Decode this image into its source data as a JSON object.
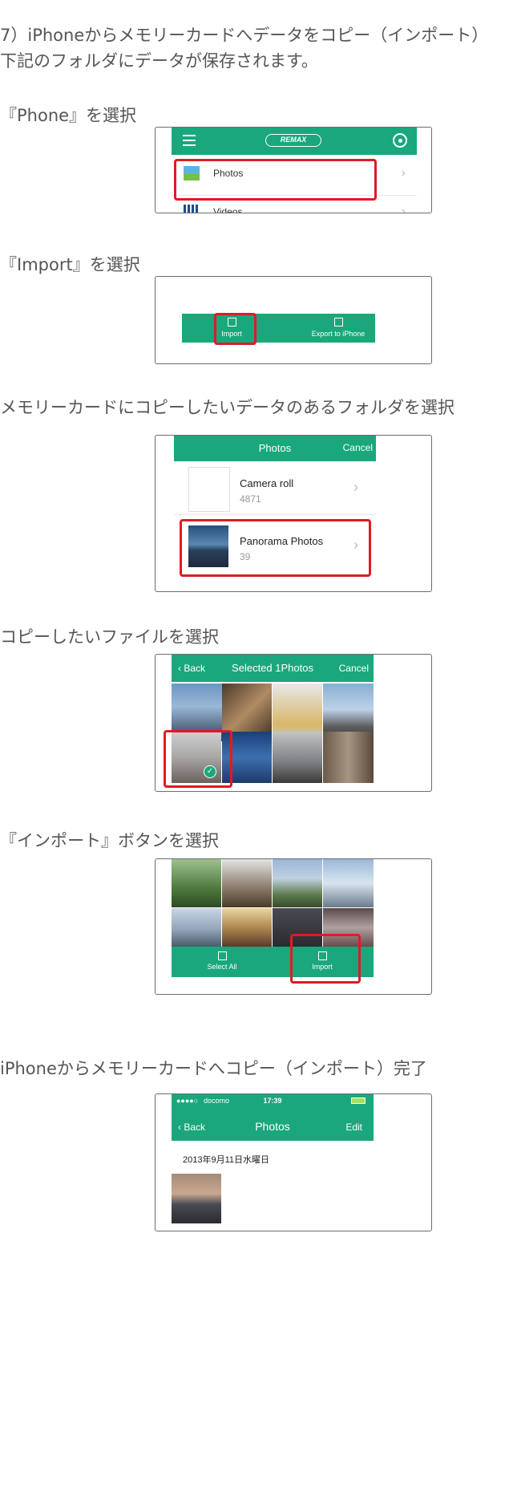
{
  "steps": {
    "title": "7）iPhoneからメモリーカードへデータをコピー（インポート）",
    "subtitle": "下記のフォルダにデータが保存されます。",
    "s1": "『Phone』を選択",
    "s2": "『Import』を選択",
    "s3": "メモリーカードにコピーしたいデータのあるフォルダを選択",
    "s4": "コピーしたいファイルを選択",
    "s5": "『インポート』ボタンを選択",
    "s6": "iPhoneからメモリーカードへコピー（インポート）完了"
  },
  "shot1": {
    "logo": "REMAX",
    "item1": "Photos",
    "item2": "Videos"
  },
  "shot2": {
    "import": "Import",
    "export": "Export to iPhone"
  },
  "shot3": {
    "header": "Photos",
    "cancel": "Cancel",
    "album1_name": "Camera roll",
    "album1_count": "4871",
    "album2_name": "Panorama Photos",
    "album2_count": "39"
  },
  "shot4": {
    "back": "Back",
    "title": "Selected 1Photos",
    "cancel": "Cancel"
  },
  "shot5": {
    "select_all": "Select All",
    "import": "Import"
  },
  "shot6": {
    "carrier": "docomo",
    "time": "17:39",
    "back": "Back",
    "title": "Photos",
    "edit": "Edit",
    "date": "2013年9月11日水曜日"
  },
  "colors": {
    "accent": "#1aa77c",
    "highlight": "#e01b22"
  }
}
